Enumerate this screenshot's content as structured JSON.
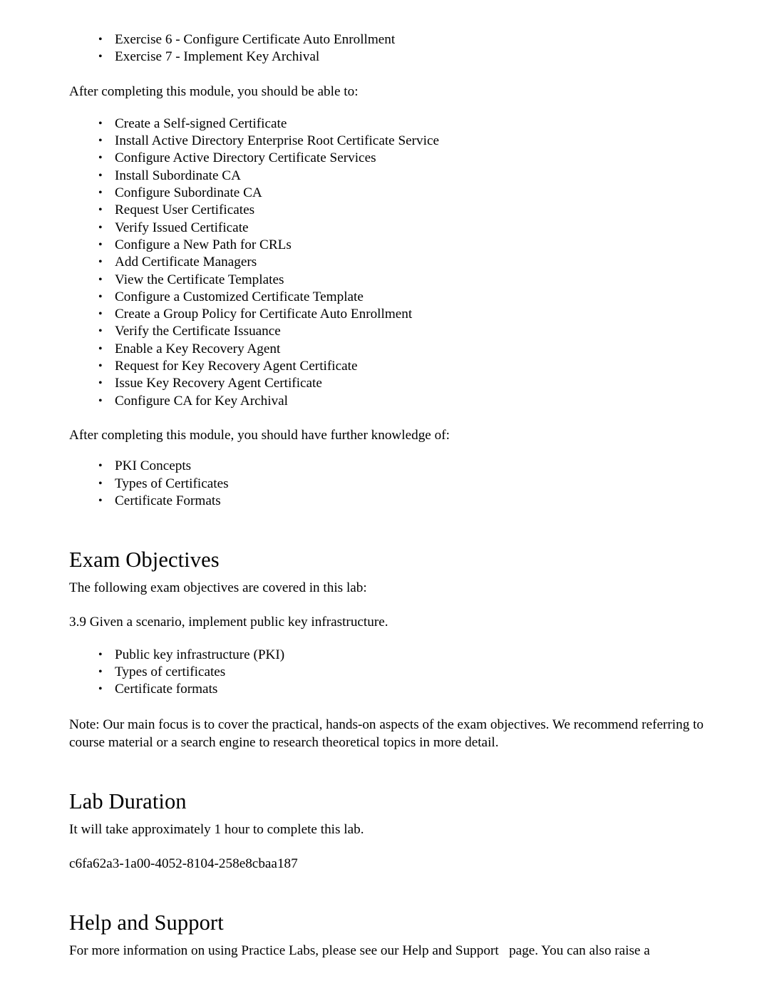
{
  "document": {
    "exercises_tail": [
      "Exercise 6 - Configure Certificate Auto Enrollment",
      "Exercise 7 - Implement Key Archival"
    ],
    "objectives_intro": "After completing this module, you should be able to:",
    "objectives": [
      "Create a Self-signed Certificate",
      "Install Active Directory Enterprise Root Certificate Service",
      "Configure Active Directory Certificate Services",
      "Install Subordinate CA",
      "Configure Subordinate CA",
      "Request User Certificates",
      "Verify Issued Certificate",
      "Configure a New Path for CRLs",
      "Add Certificate Managers",
      "View the Certificate Templates",
      "Configure a Customized Certificate Template",
      "Create a Group Policy for Certificate Auto Enrollment",
      "Verify the Certificate Issuance",
      "Enable a Key Recovery Agent",
      "Request for Key Recovery Agent Certificate",
      "Issue Key Recovery Agent Certificate",
      "Configure CA for Key Archival"
    ],
    "knowledge_intro": "After completing this module, you should have further knowledge of:",
    "knowledge": [
      "PKI Concepts",
      "Types of Certificates",
      "Certificate Formats"
    ],
    "exam_objectives": {
      "heading": "Exam Objectives",
      "intro": "The following exam objectives are covered in this lab:",
      "objective_statement": "3.9 Given a scenario, implement public key infrastructure.",
      "items": [
        "Public key infrastructure (PKI)",
        "Types of certificates",
        "Certificate formats"
      ],
      "note": "Note: Our main focus is to cover the practical, hands-on aspects of the exam objectives. We recommend referring to course material or a search engine to research theoretical topics in more detail."
    },
    "lab_duration": {
      "heading": "Lab Duration",
      "text": "It will take approximately 1 hour  to complete this lab.",
      "guid": "c6fa62a3-1a00-4052-8104-258e8cbaa187"
    },
    "help_and_support": {
      "heading": "Help and Support",
      "text_before_link": "For more information on using Practice Labs, please see our ",
      "link_text": "Help and Support",
      "text_after_link": "   page. You can also raise a"
    }
  }
}
